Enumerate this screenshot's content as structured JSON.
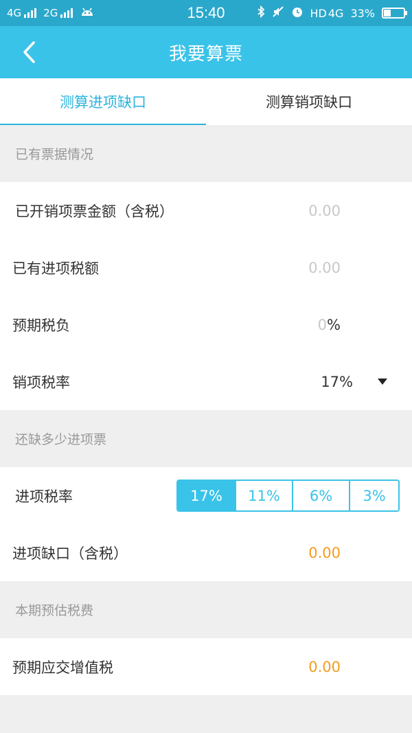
{
  "status_bar": {
    "network_1": "4G",
    "network_2": "2G",
    "time": "15:40",
    "hd_label": "HD",
    "net_right": "4G",
    "battery": "33%"
  },
  "nav": {
    "title": "我要算票"
  },
  "tabs": [
    {
      "label": "测算进项缺口",
      "active": true
    },
    {
      "label": "测算销项缺口",
      "active": false
    }
  ],
  "section_existing": {
    "header": "已有票据情况",
    "rows": {
      "sales_invoice_amount": {
        "label": "已开销项票金额（含税）",
        "placeholder": "0.00"
      },
      "input_tax_amount": {
        "label": "已有进项税额",
        "placeholder": "0.00"
      },
      "expected_tax_burden": {
        "label": "预期税负",
        "placeholder": "0",
        "suffix": "%"
      },
      "output_tax_rate": {
        "label": "销项税率",
        "value": "17%"
      }
    }
  },
  "section_missing": {
    "header": "还缺多少进项票",
    "input_tax_rate_label": "进项税率",
    "rate_options": [
      "17%",
      "11%",
      "6%",
      "3%"
    ],
    "selected_rate": "17%",
    "gap_label": "进项缺口（含税）",
    "gap_value": "0.00"
  },
  "section_estimate": {
    "header": "本期预估税费",
    "vat_label": "预期应交增值税",
    "vat_value": "0.00"
  },
  "colors": {
    "accent": "#3ac3e8",
    "status_bar": "#2aa8cc",
    "orange": "#f39c1f"
  }
}
